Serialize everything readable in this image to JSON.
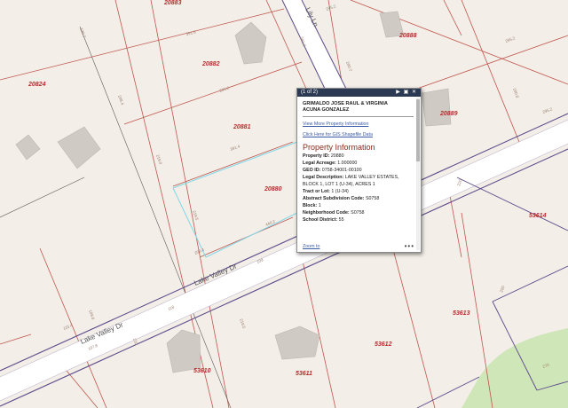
{
  "map": {
    "parcels": [
      {
        "id": "20883"
      },
      {
        "id": "20882"
      },
      {
        "id": "20824"
      },
      {
        "id": "20881"
      },
      {
        "id": "20880"
      },
      {
        "id": "20888"
      },
      {
        "id": "20889"
      },
      {
        "id": "53614"
      },
      {
        "id": "53613"
      },
      {
        "id": "53612"
      },
      {
        "id": "53611"
      },
      {
        "id": "53610"
      }
    ],
    "roads": {
      "main": "Lake Valley Dr",
      "side": "Lily Ln"
    },
    "dimensions": [
      "391.8",
      "391.8",
      "295.2",
      "391.4",
      "440.2",
      "295.2",
      "295.2",
      "219.0",
      "208.4",
      "208.4",
      "109",
      "118",
      "130.7",
      "219.5",
      "219.5",
      "115.4",
      "220",
      "200",
      "270",
      "200.7",
      "200.8",
      "295.2",
      "109.8",
      "107.8",
      "210"
    ],
    "colors": {
      "background": "#f3eee8",
      "parcel_line": "#c0564d",
      "road_edge": "#5b4a8a",
      "road_fill": "#ffffff",
      "selected_parcel": "#7fd8e8",
      "park": "#cfe6b8"
    }
  },
  "popup": {
    "header": "(1 of 2)",
    "icons": {
      "next": "play-icon",
      "maximize": "maximize-icon",
      "close": "close-icon"
    },
    "owner_line1": "GRIMALDO JOSE RAUL & VIRGINIA",
    "owner_line2": "ACUNA GONZALEZ",
    "link_more": "View More Property Information",
    "link_gis": "Click Here for GIS Shapefile Data",
    "section_title": "Property Information",
    "fields": [
      {
        "label": "Property ID:",
        "value": "20880"
      },
      {
        "label": "Legal Acreage:",
        "value": "1.000000"
      },
      {
        "label": "GEO ID:",
        "value": "0758-34001-00100"
      },
      {
        "label": "Legal Description:",
        "value": "LAKE VALLEY ESTATES, BLOCK 1, LOT 1 (U-34), ACRES 1"
      },
      {
        "label": "Tract or Lot:",
        "value": "1 (U-34)"
      },
      {
        "label": "Abstract Subdivision Code:",
        "value": "S0758"
      },
      {
        "label": "Block:",
        "value": "1"
      },
      {
        "label": "Neighborhood Code:",
        "value": "S0758"
      },
      {
        "label": "School District:",
        "value": "55"
      }
    ],
    "zoom_label": "Zoom to",
    "more_label": "•••"
  }
}
